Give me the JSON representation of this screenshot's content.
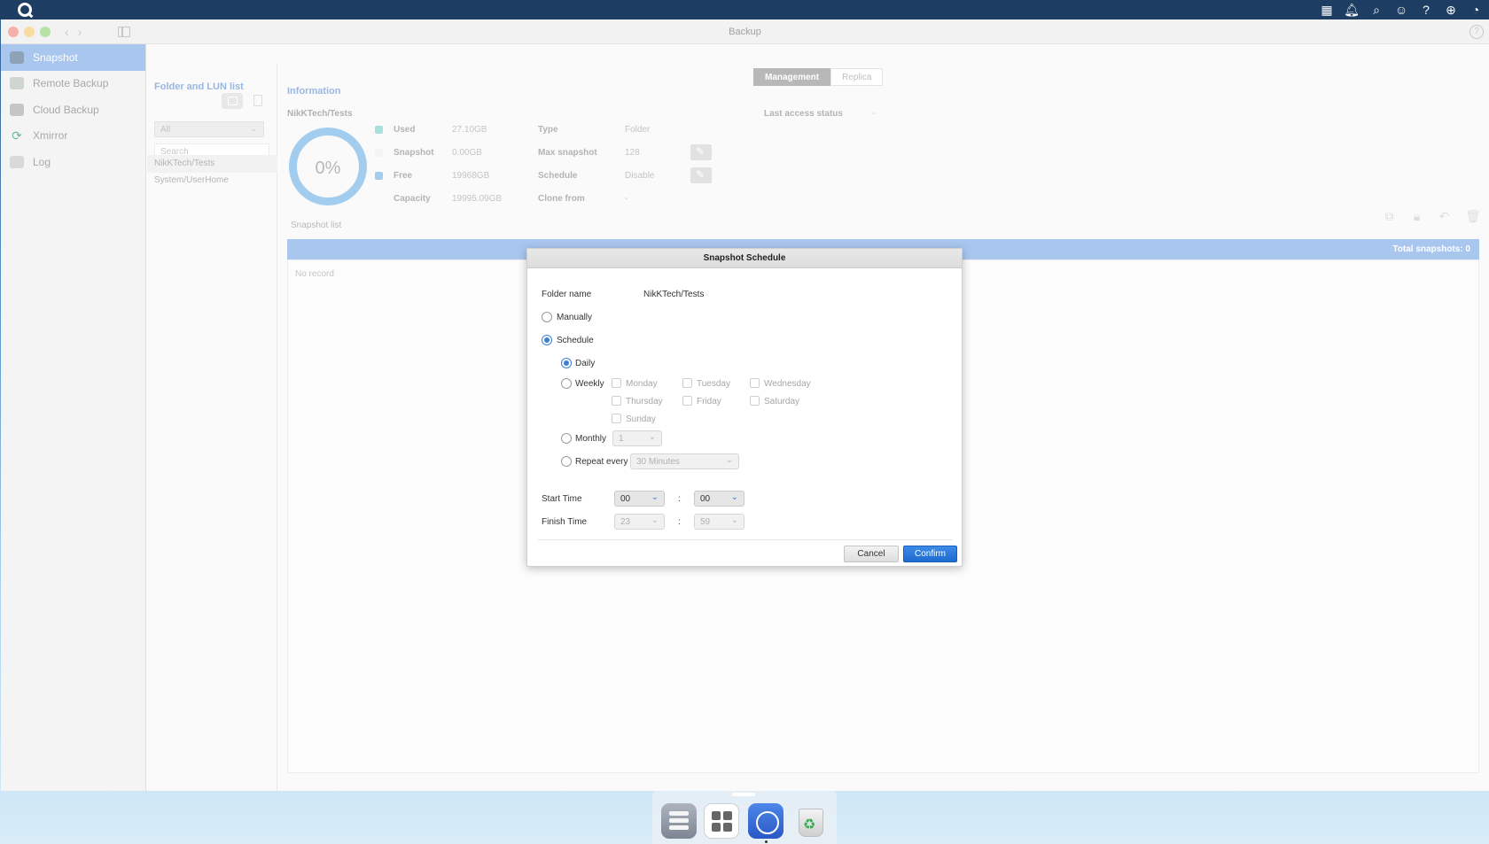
{
  "window": {
    "title": "Backup"
  },
  "sidebar": {
    "items": [
      {
        "label": "Snapshot",
        "active": true
      },
      {
        "label": "Remote Backup"
      },
      {
        "label": "Cloud Backup"
      },
      {
        "label": "Xmirror"
      },
      {
        "label": "Log"
      }
    ]
  },
  "folder_panel": {
    "title": "Folder and LUN list",
    "filter_value": "All",
    "search_placeholder": "Search",
    "items": [
      "NikKTech/Tests",
      "System/UserHome"
    ]
  },
  "tabs": [
    "Management",
    "Replica"
  ],
  "info": {
    "title": "Information",
    "folder": "NikKTech/Tests",
    "usage_percent": "0%",
    "legend": [
      {
        "label": "Used",
        "value": "27.10GB",
        "color": "#a8e0dc"
      },
      {
        "label": "Snapshot",
        "value": "0.00GB",
        "color": "#f4f4f4"
      },
      {
        "label": "Free",
        "value": "19968GB",
        "color": "#a3cdef"
      },
      {
        "label": "Capacity",
        "value": "19995.09GB",
        "color": ""
      }
    ],
    "details": [
      {
        "key": "Type",
        "value": "Folder"
      },
      {
        "key": "Max snapshot",
        "value": "128"
      },
      {
        "key": "Schedule",
        "value": "Disable"
      },
      {
        "key": "Clone from",
        "value": "-"
      }
    ],
    "last_access_label": "Last access status",
    "last_access_value": "-"
  },
  "snapshot_list": {
    "title": "Snapshot list",
    "total": "Total snapshots: 0",
    "empty": "No record"
  },
  "modal": {
    "title": "Snapshot Schedule",
    "folder_name_label": "Folder name",
    "folder_name_value": "NikKTech/Tests",
    "mode_manually": "Manually",
    "mode_schedule": "Schedule",
    "freq_daily": "Daily",
    "freq_weekly": "Weekly",
    "days": [
      "Monday",
      "Tuesday",
      "Wednesday",
      "Thursday",
      "Friday",
      "Saturday",
      "Sunday"
    ],
    "freq_monthly": "Monthly",
    "monthly_value": "1",
    "freq_repeat": "Repeat every",
    "repeat_value": "30 Minutes",
    "start_label": "Start Time",
    "start_hour": "00",
    "start_min": "00",
    "finish_label": "Finish Time",
    "finish_hour": "23",
    "finish_min": "59",
    "colon": ":",
    "cancel": "Cancel",
    "confirm": "Confirm"
  },
  "colors": {
    "accent": "#1e6ad0",
    "selection": "#a9c6ef",
    "topbar": "#1d3d63"
  }
}
